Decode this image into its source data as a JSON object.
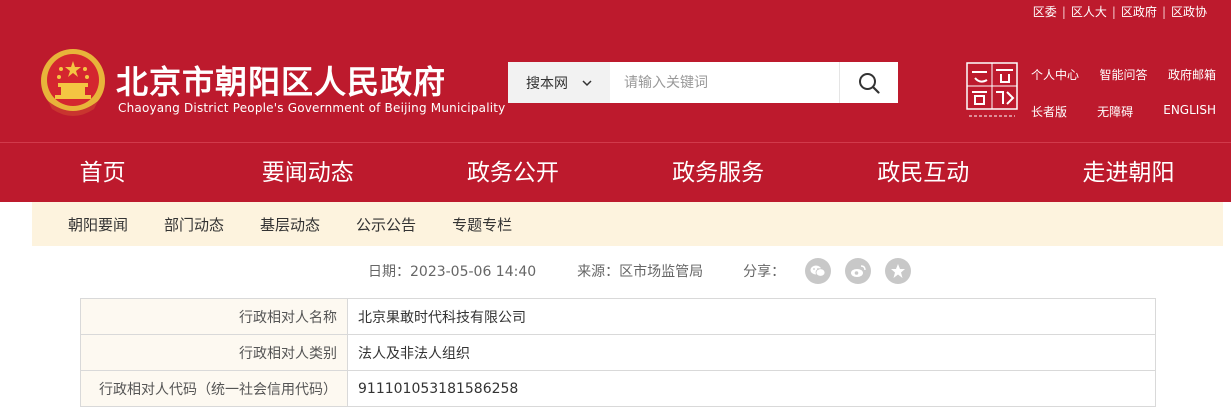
{
  "top_links": [
    "区委",
    "区人大",
    "区政府",
    "区政协"
  ],
  "site": {
    "title_cn": "北京市朝阳区人民政府",
    "title_en": "Chaoyang District People's Government of Beijing Municipality"
  },
  "search": {
    "scope": "搜本网",
    "placeholder": "请输入关键词"
  },
  "quick_links": {
    "row1": [
      "个人中心",
      "智能问答",
      "政府邮箱"
    ],
    "row2": [
      "长者版",
      "无障碍",
      "ENGLISH"
    ]
  },
  "nav": [
    "首页",
    "要闻动态",
    "政务公开",
    "政务服务",
    "政民互动",
    "走进朝阳"
  ],
  "subnav": [
    "朝阳要闻",
    "部门动态",
    "基层动态",
    "公示公告",
    "专题专栏"
  ],
  "meta": {
    "date": "日期：2023-05-06 14:40",
    "source": "来源：区市场监管局",
    "share_label": "分享："
  },
  "share_icons": [
    "wechat-icon",
    "weibo-icon",
    "qzone-icon"
  ],
  "table": [
    {
      "label": "行政相对人名称",
      "value": "北京果敢时代科技有限公司"
    },
    {
      "label": "行政相对人类别",
      "value": "法人及非法人组织"
    },
    {
      "label": "行政相对人代码（统一社会信用代码）",
      "value": "911101053181586258"
    }
  ],
  "colors": {
    "brand_red": "#bd1a2d",
    "subnav_bg": "#fdf3de",
    "table_label_bg": "#fdf9f1"
  }
}
